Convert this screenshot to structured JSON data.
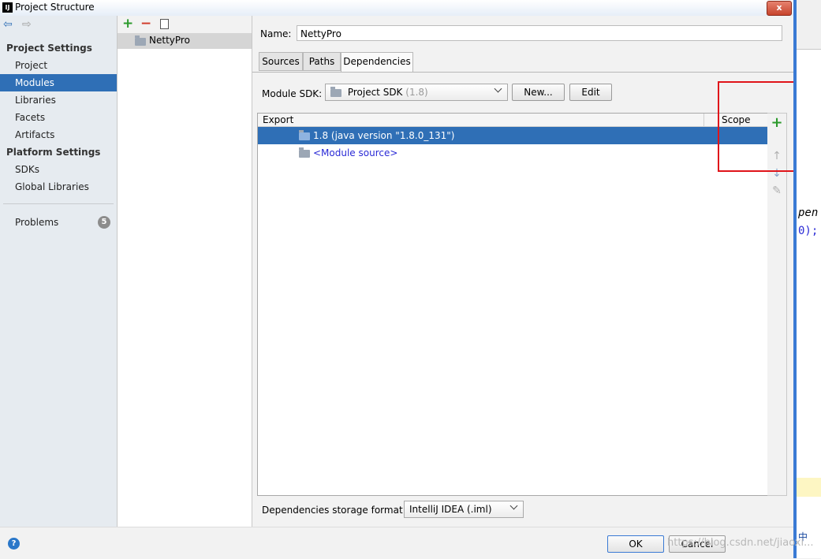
{
  "window": {
    "title": "Project Structure",
    "close_label": "x",
    "app_icon_text": "IJ"
  },
  "left_nav": {
    "project_settings_header": "Project Settings",
    "project_settings_items": [
      "Project",
      "Modules",
      "Libraries",
      "Facets",
      "Artifacts"
    ],
    "selected_item": "Modules",
    "platform_settings_header": "Platform Settings",
    "platform_settings_items": [
      "SDKs",
      "Global Libraries"
    ],
    "problems_label": "Problems",
    "problems_count": "5"
  },
  "module_list": {
    "add_icon": "+",
    "remove_icon": "−",
    "copy_icon": "copy-icon",
    "items": [
      "NettyPro"
    ]
  },
  "module_detail": {
    "name_label": "Name:",
    "name_value": "NettyPro",
    "tabs": [
      "Sources",
      "Paths",
      "Dependencies"
    ],
    "active_tab": "Dependencies",
    "sdk_label": "Module SDK:",
    "sdk_value": "Project SDK",
    "sdk_version": "(1.8)",
    "new_button": "New...",
    "edit_button": "Edit",
    "table": {
      "col_export": "Export",
      "col_scope": "Scope",
      "rows": [
        {
          "label": "1.8 (java version \"1.8.0_131\")",
          "selected": true
        },
        {
          "label": "<Module source>",
          "selected": false
        }
      ]
    },
    "storage_label": "Dependencies storage format:",
    "storage_value": "IntelliJ IDEA (.iml)"
  },
  "footer": {
    "ok_button": "OK",
    "cancel_button": "Cancel",
    "help_icon": "?"
  },
  "background_editor": {
    "line1": "pen",
    "line2": "0);",
    "ime": "中"
  },
  "watermark": "https://blog.csdn.net/jiaoxi..."
}
